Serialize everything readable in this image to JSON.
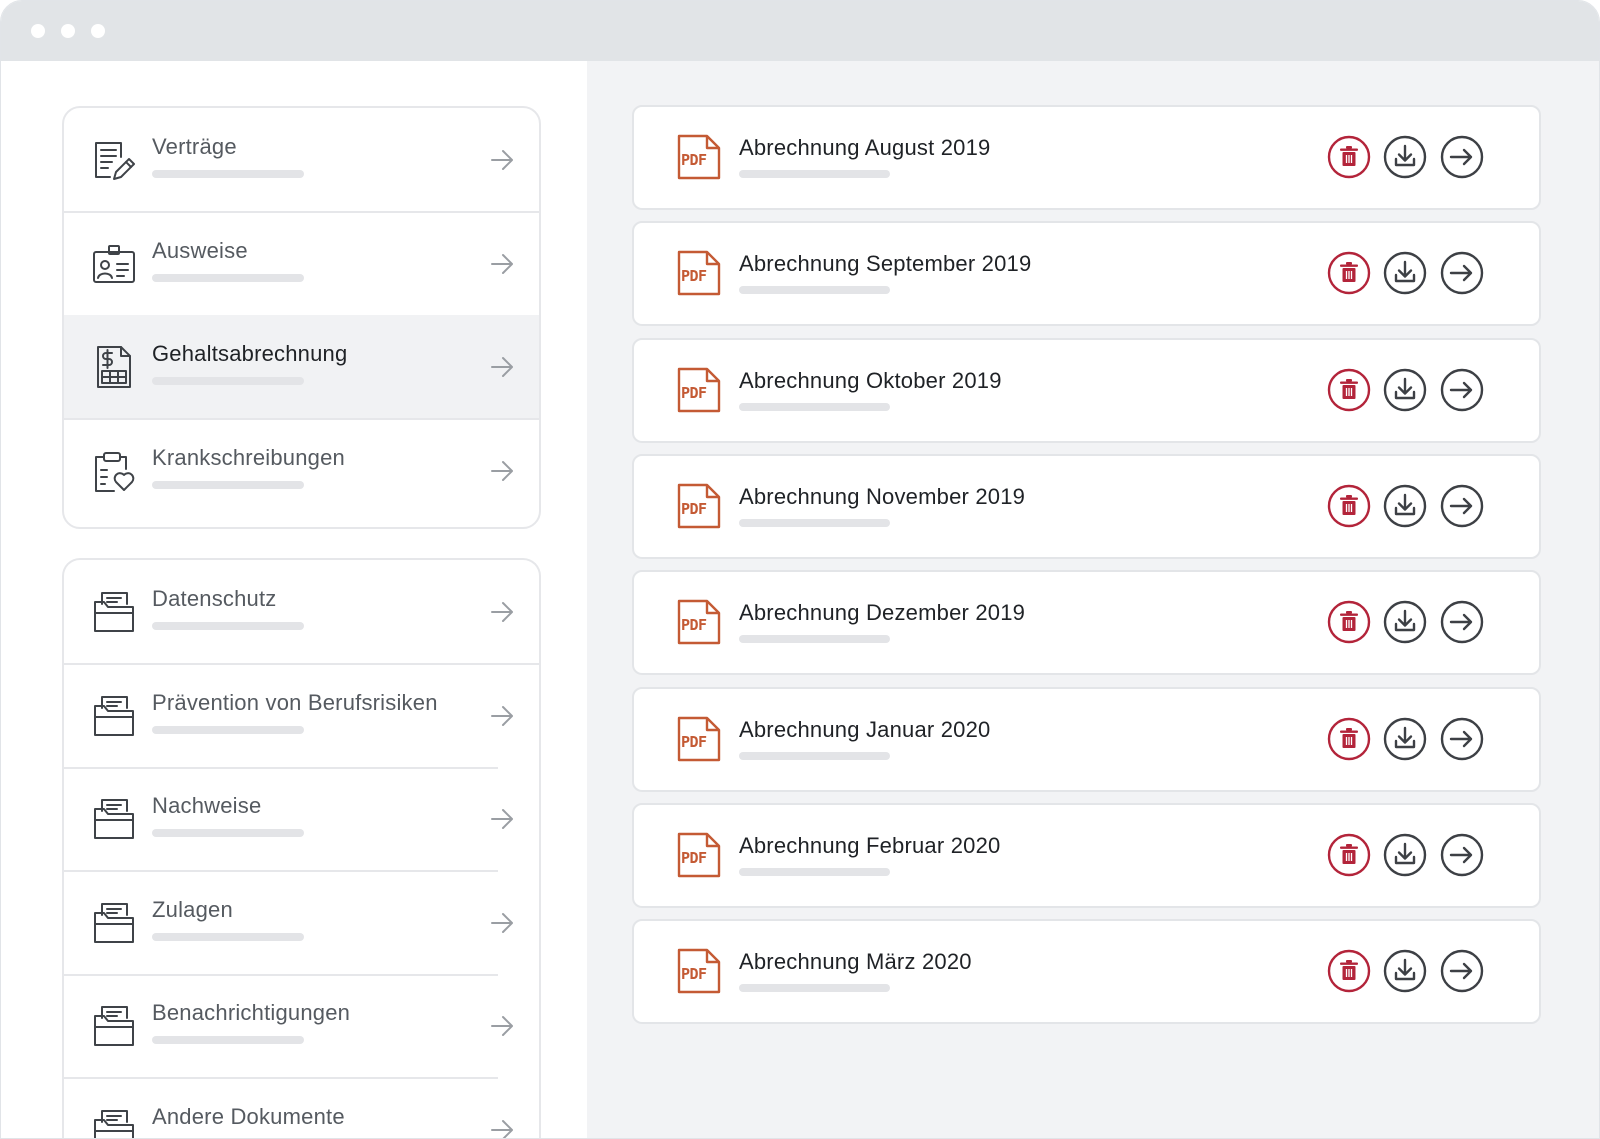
{
  "window": {
    "controls": [
      "close",
      "minimize",
      "maximize"
    ]
  },
  "sidebar": {
    "groups": [
      {
        "items": [
          {
            "label": "Verträge",
            "icon": "contract-edit-icon"
          },
          {
            "label": "Ausweise",
            "icon": "id-card-icon"
          },
          {
            "label": "Gehaltsabrechnung",
            "icon": "payslip-dollar-icon",
            "active": true
          },
          {
            "label": "Krankschreibungen",
            "icon": "clipboard-heart-icon"
          }
        ]
      },
      {
        "items": [
          {
            "label": "Datenschutz",
            "icon": "folder-icon"
          },
          {
            "label": "Prävention von Berufsrisiken",
            "icon": "folder-icon"
          },
          {
            "label": "Nachweise",
            "icon": "folder-icon"
          },
          {
            "label": "Zulagen",
            "icon": "folder-icon"
          },
          {
            "label": "Benachrichtigungen",
            "icon": "folder-icon"
          },
          {
            "label": "Andere Dokumente",
            "icon": "folder-icon"
          }
        ]
      }
    ]
  },
  "documents": {
    "file_badge": "PDF",
    "items": [
      {
        "title": "Abrechnung August 2019"
      },
      {
        "title": "Abrechnung September 2019"
      },
      {
        "title": "Abrechnung Oktober 2019"
      },
      {
        "title": "Abrechnung November 2019"
      },
      {
        "title": "Abrechnung Dezember 2019"
      },
      {
        "title": "Abrechnung Januar 2020"
      },
      {
        "title": "Abrechnung Februar 2020"
      },
      {
        "title": "Abrechnung März 2020"
      }
    ],
    "actions": [
      {
        "name": "delete",
        "icon": "trash-icon",
        "color": "#b3243a"
      },
      {
        "name": "download",
        "icon": "download-icon",
        "color": "#3d4045"
      },
      {
        "name": "open",
        "icon": "arrow-right-circle-icon",
        "color": "#3d4045"
      }
    ]
  },
  "colors": {
    "pdf_accent": "#c45a34",
    "delete_accent": "#b3243a",
    "titlebar": "#e1e4e7",
    "panel_background": "#f2f3f5"
  }
}
